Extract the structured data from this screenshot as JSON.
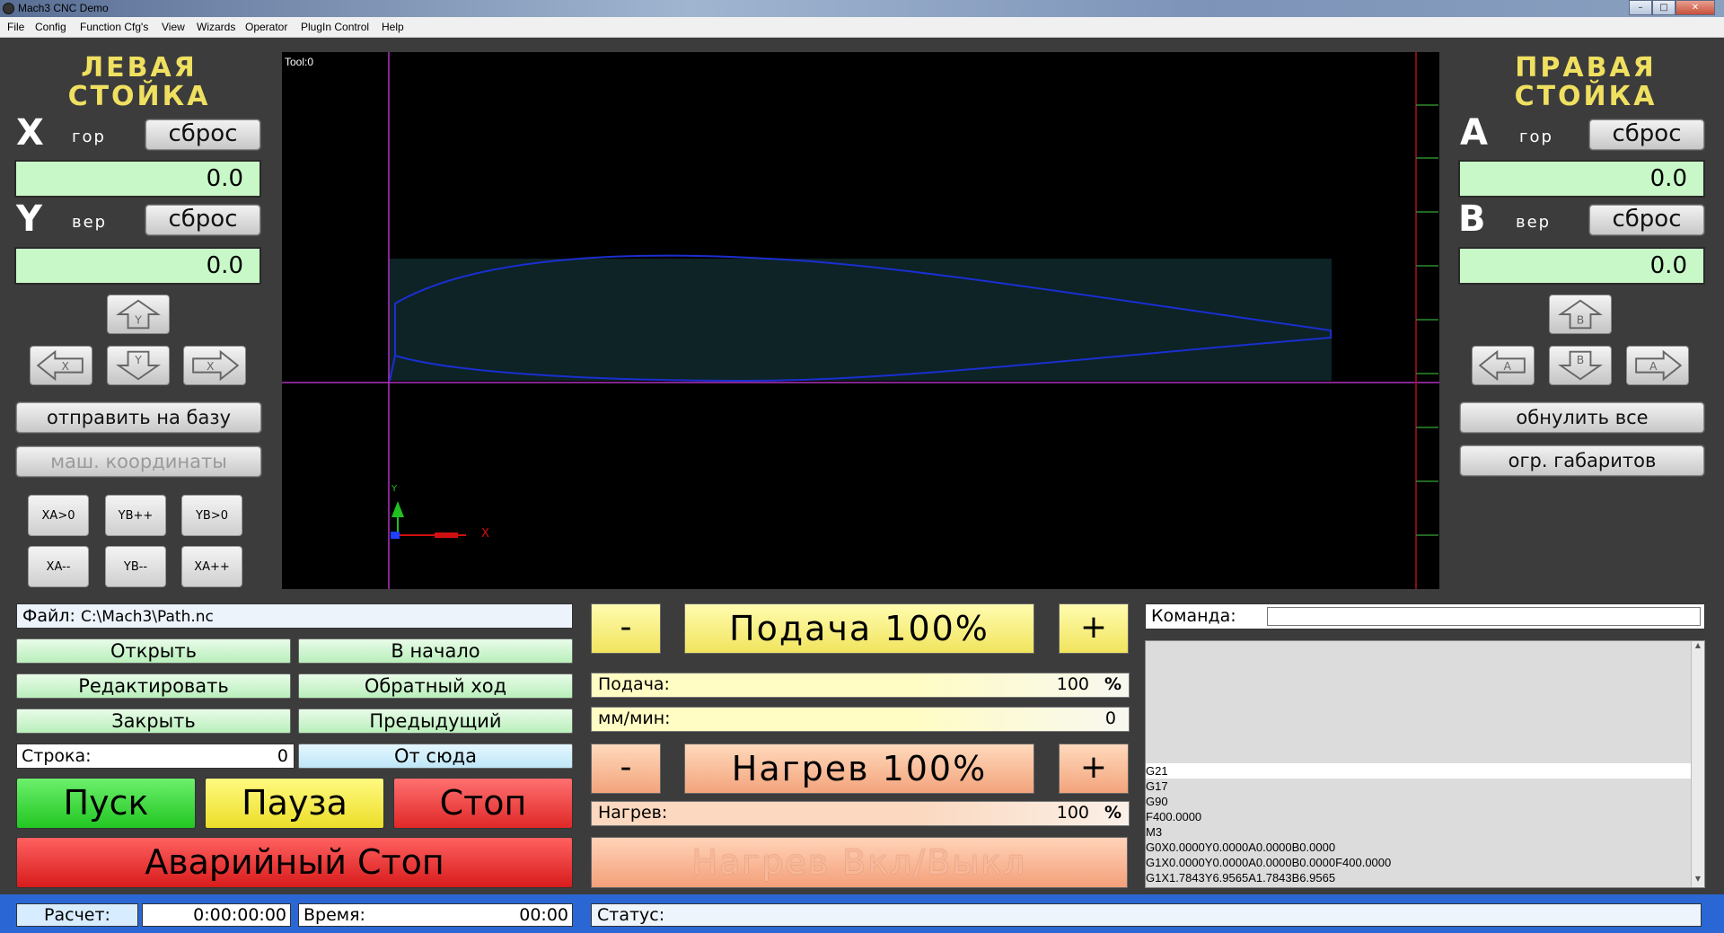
{
  "window": {
    "title": "Mach3 CNC  Demo"
  },
  "menu": [
    "File",
    "Config",
    "Function Cfg's",
    "View",
    "Wizards",
    "Operator",
    "PlugIn Control",
    "Help"
  ],
  "left": {
    "header": "ЛЕВАЯ\nСТОЙКА",
    "x_axis": "X",
    "x_sub": "гор",
    "x_reset": "сброс",
    "x_value": "0.0",
    "y_axis": "Y",
    "y_sub": "вер",
    "y_reset": "сброс",
    "y_value": "0.0",
    "home_button": "отправить на базу",
    "machine_coords_button": "маш. координаты",
    "jog_buttons": [
      "XA>0",
      "YB++",
      "YB>0",
      "XA--",
      "YB--",
      "XA++"
    ]
  },
  "right": {
    "header": "ПРАВАЯ\nСТОЙКА",
    "a_axis": "A",
    "a_sub": "гор",
    "a_reset": "сброс",
    "a_value": "0.0",
    "b_axis": "B",
    "b_sub": "вер",
    "b_reset": "сброс",
    "b_value": "0.0",
    "zero_all_button": "обнулить все",
    "limits_button": "огр. габаритов"
  },
  "toolpath": {
    "tool_label": "Tool:0",
    "axis_y_label": "Y",
    "axis_x_label": "X"
  },
  "file": {
    "label": "Файл:",
    "path": "C:\\Mach3\\Path.nc",
    "open": "Открыть",
    "to_start": "В начало",
    "edit": "Редактировать",
    "reverse": "Обратный ход",
    "close": "Закрыть",
    "previous": "Предыдущий",
    "line_label": "Строка:",
    "line_value": "0",
    "from_here": "От сюда",
    "start": "Пуск",
    "pause": "Пауза",
    "stop": "Стоп",
    "estop": "Аварийный Стоп"
  },
  "feed": {
    "minus": "-",
    "plus": "+",
    "title": "Подача 100%",
    "label": "Подача:",
    "value": "100",
    "unit": "%",
    "rate_label": "мм/мин:",
    "rate_value": "0"
  },
  "heat": {
    "minus": "-",
    "plus": "+",
    "title": "Нагрев 100%",
    "label": "Нагрев:",
    "value": "100",
    "unit": "%",
    "toggle": "Нагрев Вкл/Выкл"
  },
  "command": {
    "label": "Команда:",
    "gcode": [
      "G21",
      "G17",
      "G90",
      "F400.0000",
      "M3",
      "G0X0.0000Y0.0000A0.0000B0.0000",
      "G1X0.0000Y0.0000A0.0000B0.0000F400.0000",
      "G1X1.7843Y6.9565A1.7843B6.9565"
    ]
  },
  "status": {
    "calc_label": "Расчет:",
    "calc_value": "0:00:00:00",
    "time_label": "Время:",
    "time_value": "00:00",
    "status_label": "Статус:"
  }
}
